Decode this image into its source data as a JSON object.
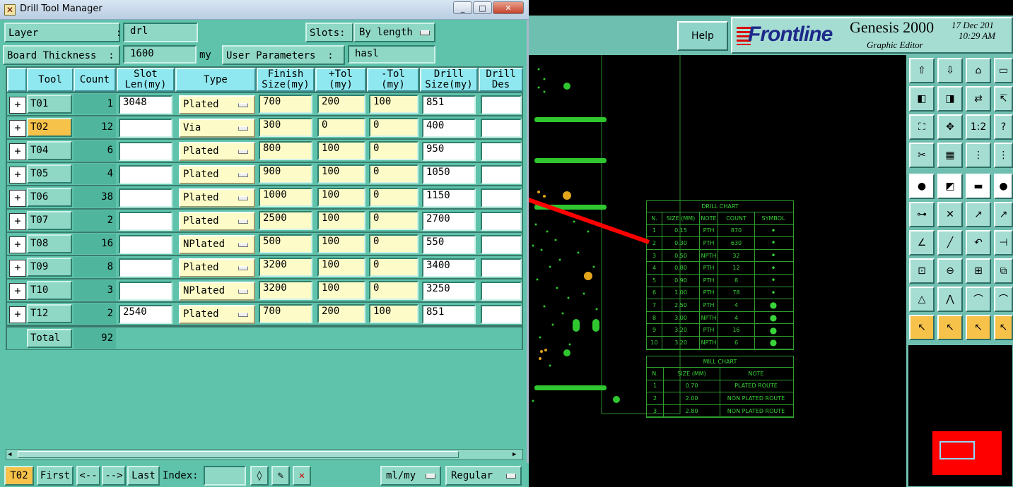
{
  "window": {
    "title": "Drill Tool Manager",
    "minimize": "_",
    "maximize": "□",
    "close": "✕"
  },
  "genesis": {
    "help_label": "Help",
    "logo_text": "Frontline",
    "product": "Genesis 2000",
    "subtitle": "Graphic Editor",
    "date": "17 Dec 201",
    "time": "10:29 AM"
  },
  "form": {
    "layer_label": "Layer             :",
    "layer_value": "drl",
    "slots_label": "Slots:",
    "slots_value": "By length",
    "board_thickness_label": "Board Thickness  :",
    "board_thickness_value": "1600",
    "board_thickness_unit": "my",
    "user_params_label": "User Parameters  :",
    "user_params_value": "hasl"
  },
  "columns": [
    [
      "Tool"
    ],
    [
      "Count"
    ],
    [
      "Slot",
      "Len(my)"
    ],
    [
      "Type"
    ],
    [
      "Finish",
      "Size(my)"
    ],
    [
      "+Tol",
      "(my)"
    ],
    [
      "-Tol",
      "(my)"
    ],
    [
      "Drill",
      "Size(my)"
    ],
    [
      "Drill",
      "Des"
    ]
  ],
  "rows": [
    {
      "tool": "T01",
      "count": "1",
      "slot_len": "3048",
      "type": "Plated",
      "finish": "700",
      "ptol": "200",
      "mtol": "100",
      "drill": "851",
      "des": ""
    },
    {
      "tool": "T02",
      "count": "12",
      "slot_len": "",
      "type": "Via",
      "finish": "300",
      "ptol": "0",
      "mtol": "0",
      "drill": "400",
      "des": ""
    },
    {
      "tool": "T04",
      "count": "6",
      "slot_len": "",
      "type": "Plated",
      "finish": "800",
      "ptol": "100",
      "mtol": "0",
      "drill": "950",
      "des": ""
    },
    {
      "tool": "T05",
      "count": "4",
      "slot_len": "",
      "type": "Plated",
      "finish": "900",
      "ptol": "100",
      "mtol": "0",
      "drill": "1050",
      "des": ""
    },
    {
      "tool": "T06",
      "count": "38",
      "slot_len": "",
      "type": "Plated",
      "finish": "1000",
      "ptol": "100",
      "mtol": "0",
      "drill": "1150",
      "des": ""
    },
    {
      "tool": "T07",
      "count": "2",
      "slot_len": "",
      "type": "Plated",
      "finish": "2500",
      "ptol": "100",
      "mtol": "0",
      "drill": "2700",
      "des": ""
    },
    {
      "tool": "T08",
      "count": "16",
      "slot_len": "",
      "type": "NPlated",
      "finish": "500",
      "ptol": "100",
      "mtol": "0",
      "drill": "550",
      "des": ""
    },
    {
      "tool": "T09",
      "count": "8",
      "slot_len": "",
      "type": "Plated",
      "finish": "3200",
      "ptol": "100",
      "mtol": "0",
      "drill": "3400",
      "des": ""
    },
    {
      "tool": "T10",
      "count": "3",
      "slot_len": "",
      "type": "NPlated",
      "finish": "3200",
      "ptol": "100",
      "mtol": "0",
      "drill": "3250",
      "des": ""
    },
    {
      "tool": "T12",
      "count": "2",
      "slot_len": "2540",
      "type": "Plated",
      "finish": "700",
      "ptol": "200",
      "mtol": "100",
      "drill": "851",
      "des": ""
    }
  ],
  "selected_tool": "T02",
  "total": {
    "label": "Total",
    "count": "92"
  },
  "bottom": {
    "current_tool": "T02",
    "first": "First",
    "prev": "<--",
    "next": "-->",
    "last": "Last",
    "index_label": "Index:",
    "index_value": "",
    "units": "ml/my",
    "mode": "Regular"
  },
  "drill_chart": {
    "title": "DRILL CHART",
    "headers": [
      "N.",
      "SIZE (MM)",
      "NOTE",
      "COUNT",
      "SYMBOL"
    ],
    "rows": [
      [
        "1",
        "0.15",
        "PTH",
        "870",
        "•"
      ],
      [
        "2",
        "0.30",
        "PTH",
        "630",
        "•"
      ],
      [
        "3",
        "0.50",
        "NPTH",
        "32",
        "•"
      ],
      [
        "4",
        "0.80",
        "PTH",
        "12",
        "•"
      ],
      [
        "5",
        "0.90",
        "PTH",
        "8",
        "•"
      ],
      [
        "6",
        "1.00",
        "PTH",
        "78",
        "•"
      ],
      [
        "7",
        "2.50",
        "PTH",
        "4",
        "●"
      ],
      [
        "8",
        "3.00",
        "NPTH",
        "4",
        "●"
      ],
      [
        "9",
        "3.20",
        "PTH",
        "16",
        "●"
      ],
      [
        "10",
        "3.20",
        "NPTH",
        "6",
        "●"
      ]
    ]
  },
  "mill_chart": {
    "title": "MILL CHART",
    "headers": [
      "N.",
      "SIZE (MM)",
      "NOTE"
    ],
    "rows": [
      [
        "1",
        "0.70",
        "PLATED ROUTE"
      ],
      [
        "2",
        "2.00",
        "NON PLATED ROUTE"
      ],
      [
        "3",
        "2.80",
        "NON PLATED ROUTE"
      ]
    ]
  },
  "toolbar_icons": [
    "zoom-up-icon",
    "zoom-down-icon",
    "home-icon",
    "panel-icon",
    "pan-left-icon",
    "pan-right-icon",
    "swap-icon",
    "cursor-icon",
    "fit-icon",
    "center-icon",
    "one-to-one-icon",
    "question-icon",
    "tools-icon",
    "grid-icon",
    "layers-icon",
    "layers-alt-icon",
    "pad-icon",
    "edit-icon",
    "ruler-icon",
    "dot-icon",
    "connect-icon",
    "cross-icon",
    "arrow-dot-icon",
    "arrow-dot-alt-icon",
    "line-angle-icon",
    "diagonal-icon",
    "undo-icon",
    "split-icon",
    "snap-icon",
    "minus-icon",
    "measure-icon",
    "group-icon",
    "triangle-icon",
    "peak-icon",
    "arch-icon",
    "arch-alt-icon",
    "select-icon",
    "select-box-icon",
    "select-rotate-icon",
    "select-path-icon"
  ],
  "colors": {
    "panel": "#5ec3aa",
    "header": "#8fe8ef",
    "selected": "#f6c24a",
    "arrow": "#ff0000"
  }
}
